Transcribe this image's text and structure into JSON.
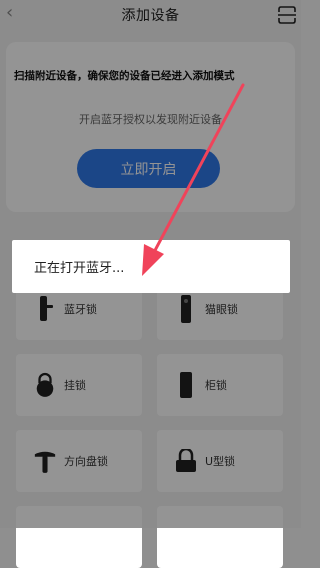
{
  "header": {
    "title": "添加设备",
    "back_icon": "chevron-left-icon",
    "scan_icon": "scan-icon"
  },
  "card": {
    "title": "扫描附近设备，确保您的设备已经进入添加模式",
    "subtitle": "开启蓝牙授权以发现附近设备",
    "button_label": "立即开启",
    "button_color": "#2f79e9"
  },
  "devices": [
    {
      "label": "蓝牙锁",
      "icon": "bluetooth-lock-icon"
    },
    {
      "label": "猫眼锁",
      "icon": "peephole-lock-icon"
    },
    {
      "label": "挂锁",
      "icon": "padlock-icon"
    },
    {
      "label": "柜锁",
      "icon": "cabinet-lock-icon"
    },
    {
      "label": "方向盘锁",
      "icon": "steering-wheel-lock-icon"
    },
    {
      "label": "U型锁",
      "icon": "u-lock-icon"
    }
  ],
  "toast": {
    "text": "正在打开蓝牙..."
  },
  "annotation": {
    "arrow_color": "#f0435a"
  }
}
